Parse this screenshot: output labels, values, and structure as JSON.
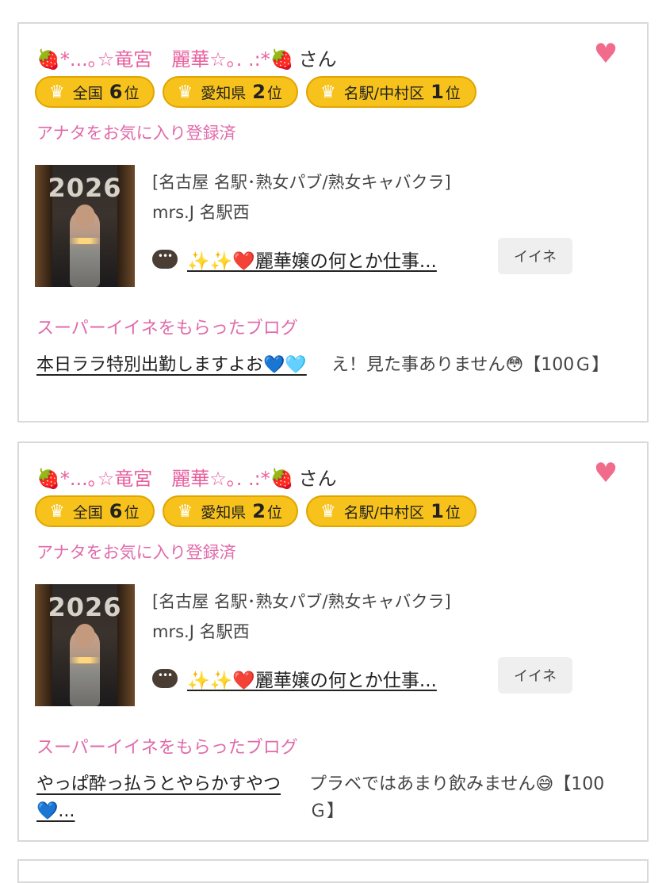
{
  "cards": [
    {
      "name_prefix": "🍓*...｡☆竜宮　麗華☆｡. .:*🍓",
      "name_suffix": "さん",
      "badges": [
        {
          "label": "全国",
          "rank": "6",
          "unit": "位"
        },
        {
          "label": "愛知県",
          "rank": "2",
          "unit": "位"
        },
        {
          "label": "名駅/中村区",
          "rank": "1",
          "unit": "位"
        }
      ],
      "fav_text": "アナタをお気に入り登録済",
      "photo_year": "2026",
      "category": "[名古屋 名駅･熟女パブ/熟女キャバクラ]",
      "shop": "mrs.J 名駅西",
      "blog_title": "✨✨❤️麗華嬢の何とか仕事...",
      "iine_label": "イイネ",
      "super_label": "スーパーイイネをもらったブログ",
      "super_blog": "本日ララ特別出勤しますよお💙🩵",
      "super_comment": "え！見た事ありません😳【100Ｇ】"
    },
    {
      "name_prefix": "🍓*...｡☆竜宮　麗華☆｡. .:*🍓",
      "name_suffix": "さん",
      "badges": [
        {
          "label": "全国",
          "rank": "6",
          "unit": "位"
        },
        {
          "label": "愛知県",
          "rank": "2",
          "unit": "位"
        },
        {
          "label": "名駅/中村区",
          "rank": "1",
          "unit": "位"
        }
      ],
      "fav_text": "アナタをお気に入り登録済",
      "photo_year": "2026",
      "category": "[名古屋 名駅･熟女パブ/熟女キャバクラ]",
      "shop": "mrs.J 名駅西",
      "blog_title": "✨✨❤️麗華嬢の何とか仕事...",
      "iine_label": "イイネ",
      "super_label": "スーパーイイネをもらったブログ",
      "super_blog": "やっぱ酔っ払うとやらかすやつ💙...",
      "super_comment": "プラベではあまり飲みません😅【100Ｇ】"
    }
  ],
  "icons": {
    "heart": "heart-icon",
    "crown": "crown-icon",
    "chat": "chat-bubble-icon"
  },
  "colors": {
    "pink": "#e8609e",
    "badge": "#f7c21c",
    "heart": "#f16c8c"
  }
}
